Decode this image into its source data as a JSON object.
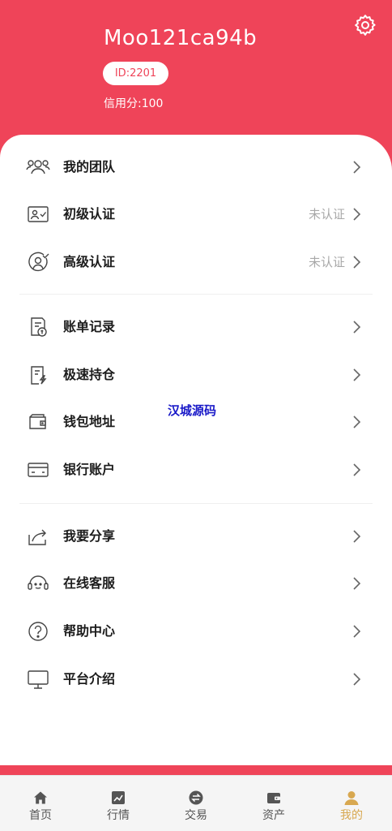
{
  "profile": {
    "username": "Moo121ca94b",
    "id_label": "ID:2201",
    "credit_label": "信用分:100"
  },
  "menu": [
    {
      "label": "我的团队",
      "status": "",
      "icon": "team-icon"
    },
    {
      "label": "初级认证",
      "status": "未认证",
      "icon": "id-card-icon"
    },
    {
      "label": "高级认证",
      "status": "未认证",
      "icon": "verified-user-icon"
    },
    {
      "label": "账单记录",
      "status": "",
      "icon": "bill-icon"
    },
    {
      "label": "极速持仓",
      "status": "",
      "icon": "position-doc-icon"
    },
    {
      "label": "钱包地址",
      "status": "",
      "icon": "wallet-icon"
    },
    {
      "label": "银行账户",
      "status": "",
      "icon": "bank-card-icon"
    },
    {
      "label": "我要分享",
      "status": "",
      "icon": "share-icon"
    },
    {
      "label": "在线客服",
      "status": "",
      "icon": "customer-service-icon"
    },
    {
      "label": "帮助中心",
      "status": "",
      "icon": "help-icon"
    },
    {
      "label": "平台介绍",
      "status": "",
      "icon": "monitor-icon"
    }
  ],
  "watermark": "汉城源码",
  "tabs": [
    {
      "label": "首页",
      "icon": "home-icon",
      "active": false
    },
    {
      "label": "行情",
      "icon": "chart-icon",
      "active": false
    },
    {
      "label": "交易",
      "icon": "exchange-icon",
      "active": false
    },
    {
      "label": "资产",
      "icon": "wallet-icon",
      "active": false
    },
    {
      "label": "我的",
      "icon": "user-icon",
      "active": true
    }
  ],
  "colors": {
    "brand": "#ef4459",
    "active_tab": "#d8a850",
    "status_text": "#a8a8a8"
  }
}
